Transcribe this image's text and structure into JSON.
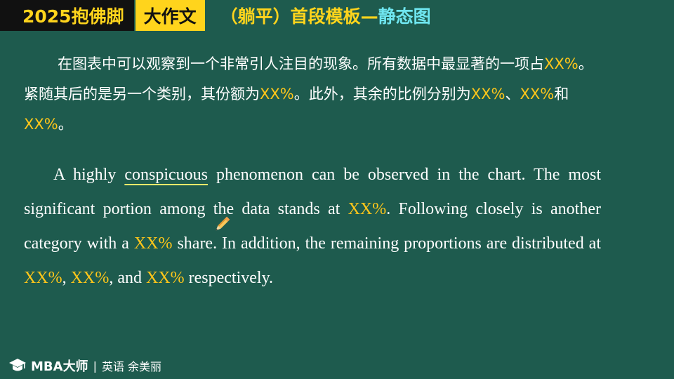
{
  "header": {
    "badge_year": "2025抱佛脚",
    "badge_type": "大作文",
    "title_main": "（躺平）首段模板—",
    "title_sub": "静态图"
  },
  "chinese_paragraph": {
    "t1": "在图表中可以观察到一个非常引人注目的现象。所有数据中最显著的一项占",
    "p1": "XX%",
    "t2": "。紧随其后的是另一个类别，其份额为",
    "p2": "XX%",
    "t3": "。此外，其余的比例分别为",
    "p3": "XX%",
    "t4": "、",
    "p4": "XX%",
    "t5": "和",
    "p5": "XX%",
    "t6": "。"
  },
  "english_paragraph": {
    "t1": "A highly ",
    "underlined": "conspicuous",
    "t2": " phenomenon can be observed in the chart. The most significant portion among the data stands at ",
    "p1": "XX%",
    "t3": ". Following closely is another category with a ",
    "p2": "XX%",
    "t4": " share. In addition, the remaining proportions are distributed at ",
    "p3": "XX%",
    "t5": ", ",
    "p4": "XX%",
    "t6": ", and ",
    "p5": "XX%",
    "t7": " respectively."
  },
  "footer": {
    "brand": "MBA大师",
    "separator": "|",
    "teacher": "英语 余美丽",
    "logo_icon": "graduation-cap-icon"
  },
  "cursor": {
    "icon": "pen-cursor-icon"
  },
  "colors": {
    "background": "#1e5b4e",
    "highlight": "#ffc61a",
    "badge_yellow": "#ffd41c",
    "title_cyan": "#6fe6f0"
  }
}
